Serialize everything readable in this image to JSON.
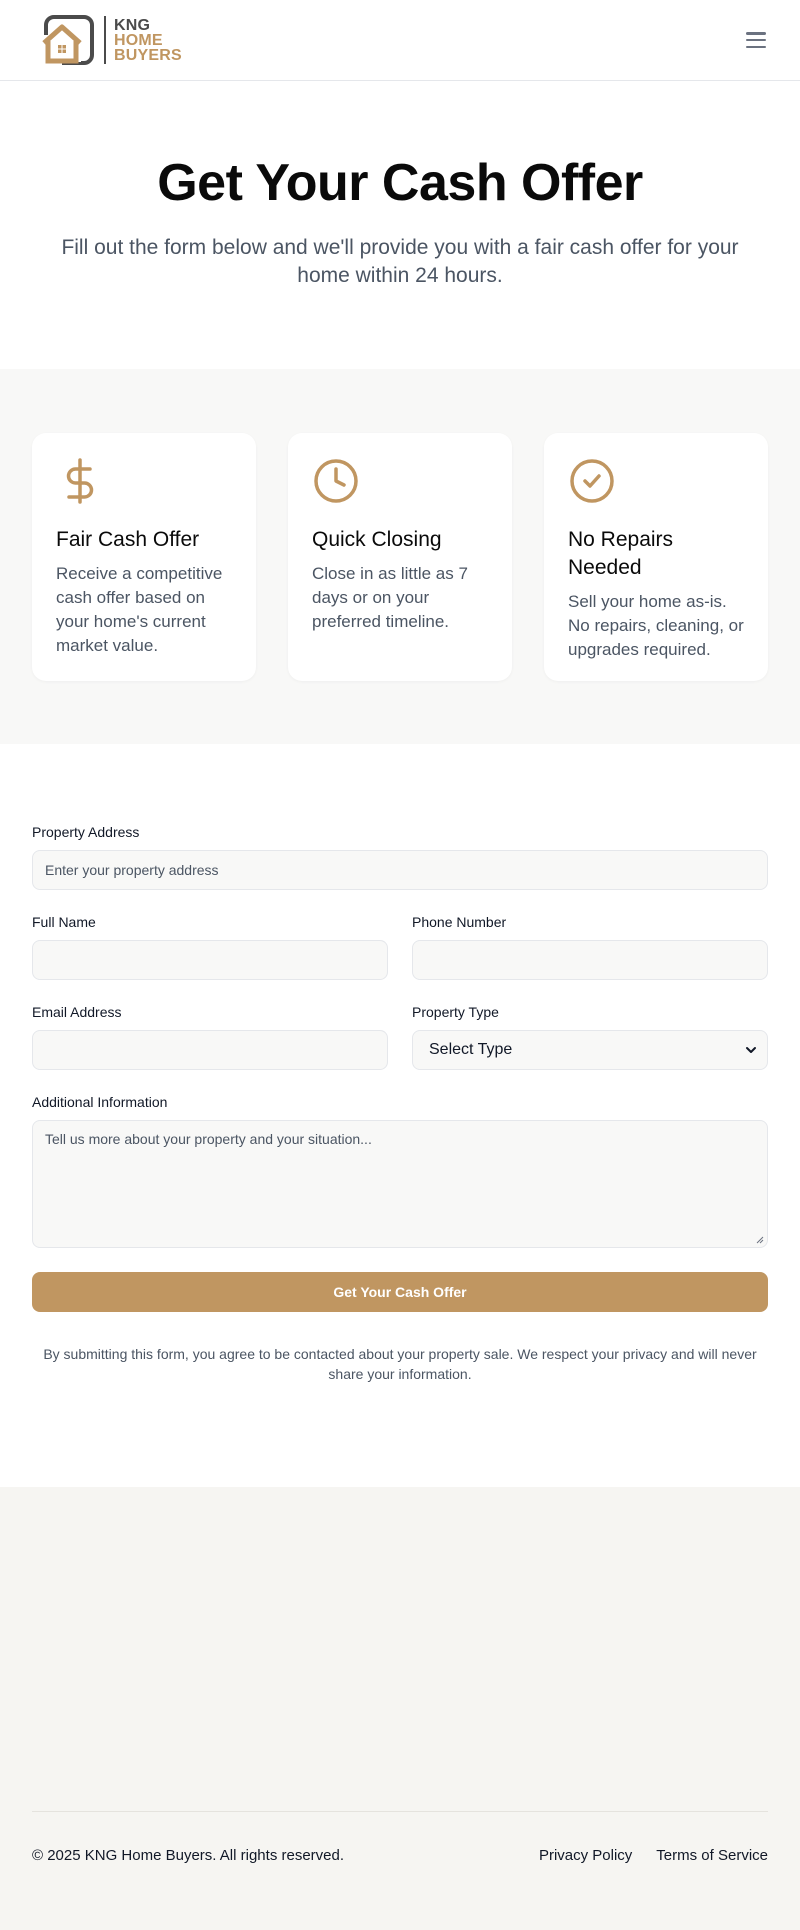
{
  "brand": {
    "line1": "KNG",
    "line2": "HOME",
    "line3": "BUYERS",
    "accent_color": "#c09661",
    "dark_color": "#4b4b4b"
  },
  "header": {
    "menu_icon": "hamburger-menu-icon"
  },
  "hero": {
    "title": "Get Your Cash Offer",
    "subtitle": "Fill out the form below and we'll provide you with a fair cash offer for your home within 24 hours."
  },
  "features": [
    {
      "icon": "dollar-sign-icon",
      "title": "Fair Cash Offer",
      "description": "Receive a competitive cash offer based on your home's current market value."
    },
    {
      "icon": "clock-icon",
      "title": "Quick Closing",
      "description": "Close in as little as 7 days or on your preferred timeline."
    },
    {
      "icon": "check-circle-icon",
      "title": "No Repairs Needed",
      "description": "Sell your home as-is. No repairs, cleaning, or upgrades required."
    }
  ],
  "form": {
    "address": {
      "label": "Property Address",
      "placeholder": "Enter your property address",
      "value": ""
    },
    "name": {
      "label": "Full Name",
      "placeholder": "",
      "value": ""
    },
    "phone": {
      "label": "Phone Number",
      "placeholder": "",
      "value": ""
    },
    "email": {
      "label": "Email Address",
      "placeholder": "",
      "value": ""
    },
    "type": {
      "label": "Property Type",
      "selected": "Select Type"
    },
    "info": {
      "label": "Additional Information",
      "placeholder": "Tell us more about your property and your situation...",
      "value": ""
    },
    "submit_label": "Get Your Cash Offer",
    "disclaimer": "By submitting this form, you agree to be contacted about your property sale. We respect your privacy and will never share your information."
  },
  "footer": {
    "copyright": "© 2025 KNG Home Buyers. All rights reserved.",
    "privacy": "Privacy Policy",
    "terms": "Terms of Service"
  }
}
